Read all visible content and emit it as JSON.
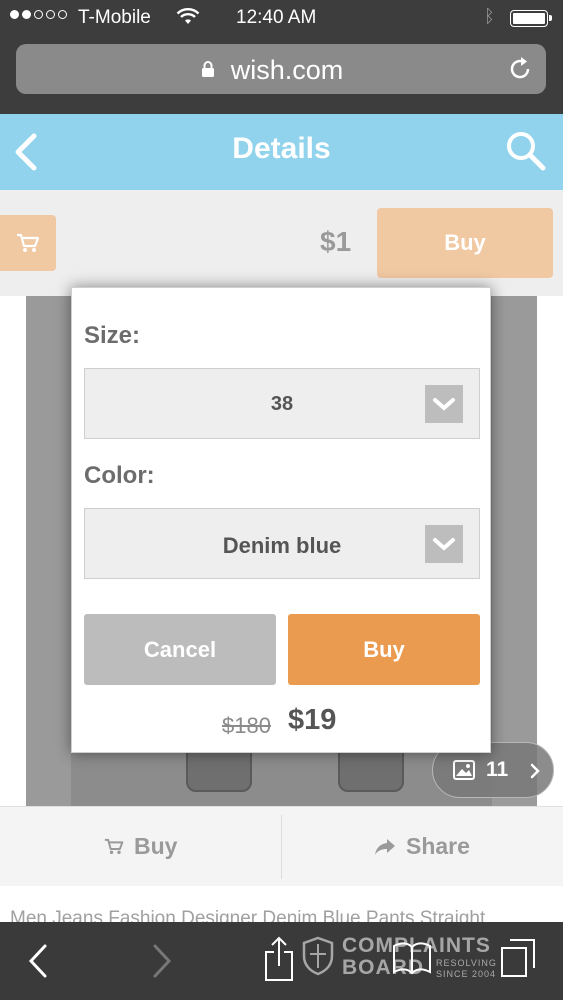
{
  "status_bar": {
    "carrier": "T-Mobile",
    "time": "12:40 AM"
  },
  "browser": {
    "url": "wish.com"
  },
  "header": {
    "title": "Details"
  },
  "purchase": {
    "price": "$1",
    "buy_label": "Buy"
  },
  "gallery": {
    "count": "11"
  },
  "actions": {
    "buy_label": "Buy",
    "share_label": "Share"
  },
  "description": {
    "text": "Men Jeans Fashion Designer Denim Blue Pants Straight"
  },
  "modal": {
    "size_label": "Size:",
    "size_value": "38",
    "color_label": "Color:",
    "color_value": "Denim blue",
    "cancel_label": "Cancel",
    "buy_label": "Buy",
    "original_price": "$180",
    "sale_price": "$19"
  },
  "watermark": {
    "line1": "COMPLAINTS",
    "line2": "BOARD",
    "tagline1": "RESOLVING",
    "tagline2": "SINCE 2004"
  },
  "colors": {
    "header": "#91d3ec",
    "buy_orange": "#eb9b50",
    "buy_disabled": "#f0c8a2",
    "cancel_gray": "#bcbcbc"
  }
}
